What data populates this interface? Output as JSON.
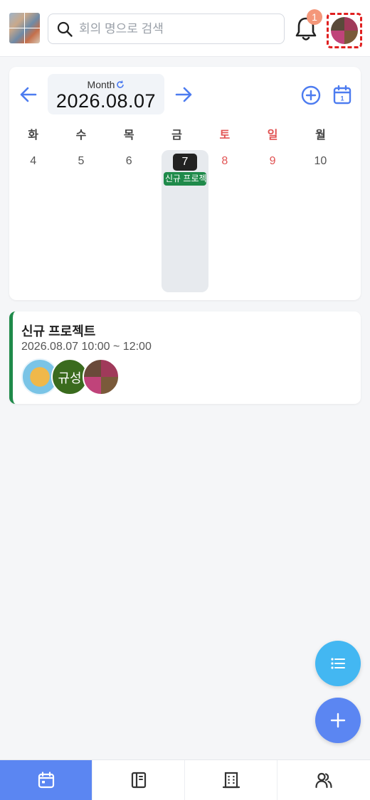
{
  "header": {
    "search_placeholder": "회의 명으로 검색",
    "notification_count": "1"
  },
  "calendar": {
    "view_mode": "Month",
    "current_date": "2026.08.07",
    "weekdays": [
      "화",
      "수",
      "목",
      "금",
      "토",
      "일",
      "월"
    ],
    "days": [
      "4",
      "5",
      "6",
      "7",
      "8",
      "9",
      "10"
    ],
    "today": "7",
    "today_event_chip": "신규 프로젝트"
  },
  "event": {
    "title": "신규 프로젝트",
    "time": "2026.08.07 10:00 ~ 12:00",
    "participant_initials": "규성",
    "accent_color": "#1f8a4a"
  },
  "colors": {
    "primary": "#5b86f2",
    "fab_list": "#43b7f2",
    "weekend": "#e25555",
    "badge": "#f4977a"
  },
  "icons": {
    "bottom_nav": [
      "calendar-icon",
      "notebook-icon",
      "building-icon",
      "users-icon"
    ]
  }
}
